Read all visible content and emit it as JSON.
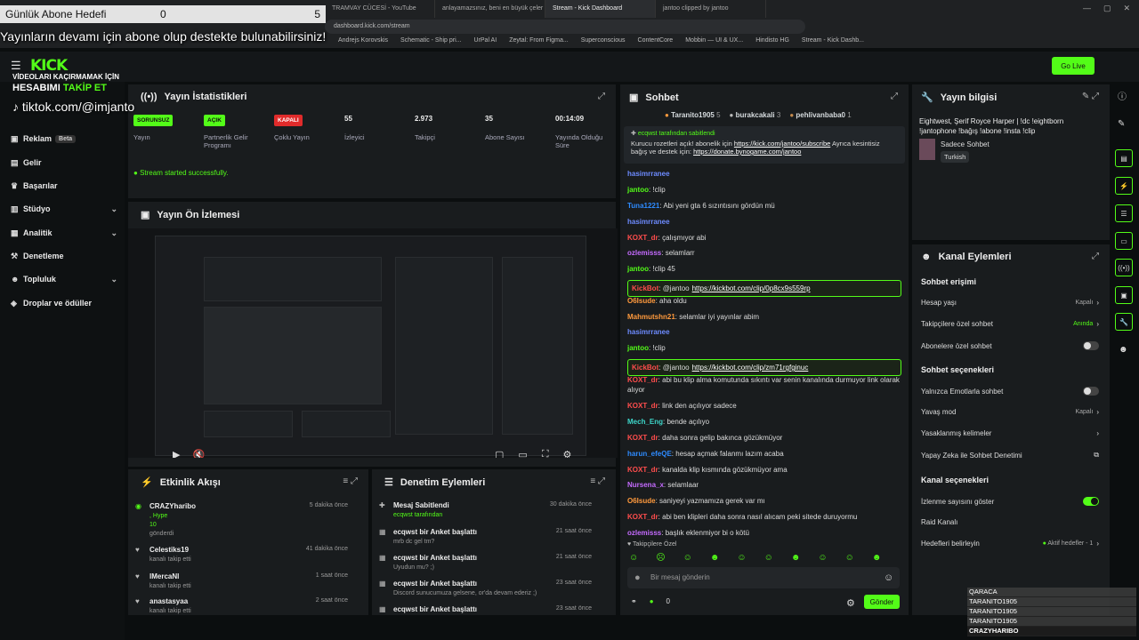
{
  "overlay": {
    "goal_label": "Günlük Abone Hedefi",
    "goal_current": "0",
    "goal_max": "5",
    "ticker": "Yayınların devamı için abone olup destekte bulunabilirsiniz!",
    "promo_line1": "VİDEOLARI KAÇIRMAMAK İÇİN",
    "promo_line2a": "HESABIMI ",
    "promo_line2b": "TAKİP ET",
    "tiktok": "tiktok.com/@imjanto"
  },
  "browser": {
    "tabs": [
      "TRAMVAY CÜCESİ - YouTube",
      "anlayamazsınız, beni en büyük çeler",
      "Stream - Kick Dashboard",
      "jantoo clipped by jantoo"
    ],
    "url": "dashboard.kick.com/stream",
    "bookmarks": [
      "Andrejs Korovskis",
      "Schematic - Ship pri...",
      "UrPal AI",
      "Zeytal: From Figma...",
      "Superconscious",
      "ContentCore",
      "Mobbin — UI & UX...",
      "Hindisto HG",
      "Stream - Kick Dashb..."
    ]
  },
  "app": {
    "logo": "KICK",
    "go_live": "Go Live"
  },
  "sidebar": {
    "items": [
      {
        "label": "Reklam",
        "badge": "Beta"
      },
      {
        "label": "Gelir"
      },
      {
        "label": "Başarılar"
      },
      {
        "label": "Stüdyo"
      },
      {
        "label": "Analitik"
      },
      {
        "label": "Denetleme"
      },
      {
        "label": "Topluluk"
      },
      {
        "label": "Droplar ve ödüller"
      }
    ]
  },
  "stats": {
    "title": "Yayın İstatistikleri",
    "items": [
      {
        "pill": "SORUNSUZ",
        "label": "Yayın"
      },
      {
        "pill": "AÇIK",
        "label": "Partnerlik Gelir Programı"
      },
      {
        "pill": "KAPALI",
        "label": "Çoklu Yayın"
      },
      {
        "value": "55",
        "label": "İzleyici"
      },
      {
        "value": "2.973",
        "label": "Takipçi"
      },
      {
        "value": "35",
        "label": "Abone Sayısı"
      },
      {
        "value": "00:14:09",
        "label": "Yayında Olduğu Süre"
      }
    ],
    "status": "Stream started successfully."
  },
  "preview": {
    "title": "Yayın Ön İzlemesi"
  },
  "activity": {
    "title": "Etkinlik Akışı",
    "items": [
      {
        "name": "CRAZYharibo",
        "sub1": ", Hype",
        "sub2": "10",
        "sub3": "gönderdi",
        "time": "5 dakika önce"
      },
      {
        "name": "Celestiks19",
        "sub1": "kanalı takip etti",
        "time": "41 dakika önce"
      },
      {
        "name": "lMercaNl",
        "sub1": "kanalı takip etti",
        "time": "1 saat önce"
      },
      {
        "name": "anastasyaa",
        "sub1": "kanalı takip etti",
        "time": "2 saat önce"
      }
    ]
  },
  "moderation": {
    "title": "Denetim Eylemleri",
    "items": [
      {
        "title": "Mesaj Sabitlendi",
        "sub": "ecqwst tarafından",
        "time": "30 dakika önce"
      },
      {
        "title": "ecqwst bir Anket başlattı",
        "sub": "mrb dc gel tm?",
        "time": "21 saat önce"
      },
      {
        "title": "ecqwst bir Anket başlattı",
        "sub": "Uyudun mu? ;)",
        "time": "21 saat önce"
      },
      {
        "title": "ecqwst bir Anket başlattı",
        "sub": "Discord sunucumuza gelsene, or'da devam ederiz ;)",
        "time": "23 saat önce"
      },
      {
        "title": "ecqwst bir Anket başlattı",
        "sub": "",
        "time": "23 saat önce"
      }
    ]
  },
  "chat": {
    "title": "Sohbet",
    "top": [
      {
        "name": "Taranito1905",
        "n": "5"
      },
      {
        "name": "burakcakali",
        "n": "3"
      },
      {
        "name": "pehlivanbaba0",
        "n": "1"
      }
    ],
    "pinned_by": "ecqwst tarafından sabitlendi",
    "pinned_text": "Kurucu rozetleri açık! abonelik için",
    "pinned_link1": "https://kick.com/jantoo/subscribe",
    "pinned_text2": "Ayrıca kesintisiz bağış ve destek için:",
    "pinned_link2": "https://donate.bynogame.com/jantoo",
    "messages": [
      {
        "user": "hasimrranee",
        "color": "#6d8bff",
        "text": ""
      },
      {
        "user": "jantoo",
        "color": "#53fc18",
        "text": "!clip"
      },
      {
        "user": "Tuna1221",
        "color": "#2e8bff",
        "text": "Abi yeni gta 6 sızıntısını gördün mü"
      },
      {
        "user": "hasimrranee",
        "color": "#6d8bff",
        "text": ""
      },
      {
        "user": "KOXT_dr",
        "color": "#ff4d4d",
        "text": "çalışmıyor abi"
      },
      {
        "user": "ozlemisss",
        "color": "#c56bff",
        "text": "selamlarr"
      },
      {
        "user": "jantoo",
        "color": "#53fc18",
        "text": "!clip 45"
      },
      {
        "user": "KickBot",
        "color": "#ff4d4d",
        "text": "@jantoo",
        "link": "https://kickbot.com/clip/0p8cx9s559rp"
      },
      {
        "user": "O6Isude",
        "color": "#ff9a3d",
        "text": "aha oldu"
      },
      {
        "user": "Mahmutshn21",
        "color": "#ff9a3d",
        "text": "selamlar iyi yayınlar abim"
      },
      {
        "user": "hasimrranee",
        "color": "#6d8bff",
        "text": ""
      },
      {
        "user": "jantoo",
        "color": "#53fc18",
        "text": "!clip"
      },
      {
        "user": "KickBot",
        "color": "#ff4d4d",
        "text": "@jantoo",
        "link": "https://kickbot.com/clip/zm71rgfginuc"
      },
      {
        "user": "KOXT_dr",
        "color": "#ff4d4d",
        "text": "abi bu klip alma komutunda sıkıntı var senin kanalında durmuyor link olarak alıyor"
      },
      {
        "user": "KOXT_dr",
        "color": "#ff4d4d",
        "text": "link den açılıyor sadece"
      },
      {
        "user": "Mech_Eng",
        "color": "#3dd6c9",
        "text": "bende açılıyo"
      },
      {
        "user": "KOXT_dr",
        "color": "#ff4d4d",
        "text": "daha sonra gelip bakınca gözükmüyor"
      },
      {
        "user": "harun_efeQE",
        "color": "#2e8bff",
        "text": "hesap açmak falanmı lazım acaba"
      },
      {
        "user": "KOXT_dr",
        "color": "#ff4d4d",
        "text": "kanalda klip kısmında gözükmüyor ama"
      },
      {
        "user": "Nursena_x",
        "color": "#c56bff",
        "text": "selamlaar"
      },
      {
        "user": "O6Isude",
        "color": "#ff9a3d",
        "text": "saniyeyi yazmamıza gerek var mı"
      },
      {
        "user": "KOXT_dr",
        "color": "#ff4d4d",
        "text": "abi ben klipleri daha sonra nasıl alıcam peki sitede duruyormu"
      },
      {
        "user": "ozlemisss",
        "color": "#c56bff",
        "text": "başlık eklenmiyor bi o kötü"
      }
    ],
    "followers_only": "Takipçilere Özel",
    "input_placeholder": "Bir mesaj gönderin",
    "send": "Gönder",
    "count": "0"
  },
  "streaminfo": {
    "title": "Yayın bilgisi",
    "text": "Eightwest, Şerif Royce Harper | !dc !eightborn !jantophone !bağış !abone !insta !clip",
    "category": "Sadece Sohbet",
    "tag": "Turkish"
  },
  "channel": {
    "title": "Kanal Eylemleri",
    "sec1": "Sohbet erişimi",
    "rows1": [
      {
        "label": "Hesap yaşı",
        "value": "Kapalı"
      },
      {
        "label": "Takipçilere özel sohbet",
        "value": "Anında"
      },
      {
        "label": "Abonelere özel sohbet",
        "value": ""
      }
    ],
    "sec2": "Sohbet seçenekleri",
    "rows2": [
      {
        "label": "Yalnızca Emotlarla sohbet",
        "value": ""
      },
      {
        "label": "Yavaş mod",
        "value": "Kapalı"
      },
      {
        "label": "Yasaklanmış kelimeler",
        "value": ""
      },
      {
        "label": "Yapay Zeka ile Sohbet Denetimi",
        "value": ""
      }
    ],
    "sec3": "Kanal seçenekleri",
    "rows3": [
      {
        "label": "İzlenme sayısını göster",
        "value": ""
      },
      {
        "label": "Raid Kanalı",
        "value": ""
      },
      {
        "label": "Hedefleri belirleyin",
        "value": "Aktif hedefler - 1"
      }
    ]
  },
  "gifters": [
    "QARACA",
    "TARANITO1905",
    "TARANITO1905",
    "TARANITO1905",
    "CRAZYHARIBO"
  ],
  "colors": {
    "accent": "#53fc18",
    "panel": "#191c1e",
    "bg": "#0b0e0f"
  }
}
